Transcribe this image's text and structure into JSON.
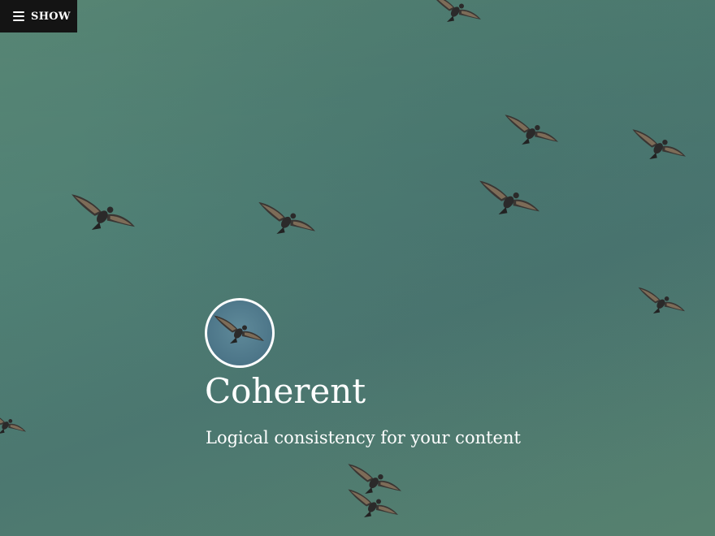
{
  "menu": {
    "label": "SHOW",
    "icon": "hamburger-icon"
  },
  "site": {
    "title": "Coherent",
    "tagline": "Logical consistency for your content",
    "logo_icon": "bird-icon"
  },
  "colors": {
    "sky_top": "#5a8a78",
    "sky_mid": "#4a7570",
    "menu_bg": "#141414",
    "text": "#ffffff"
  }
}
